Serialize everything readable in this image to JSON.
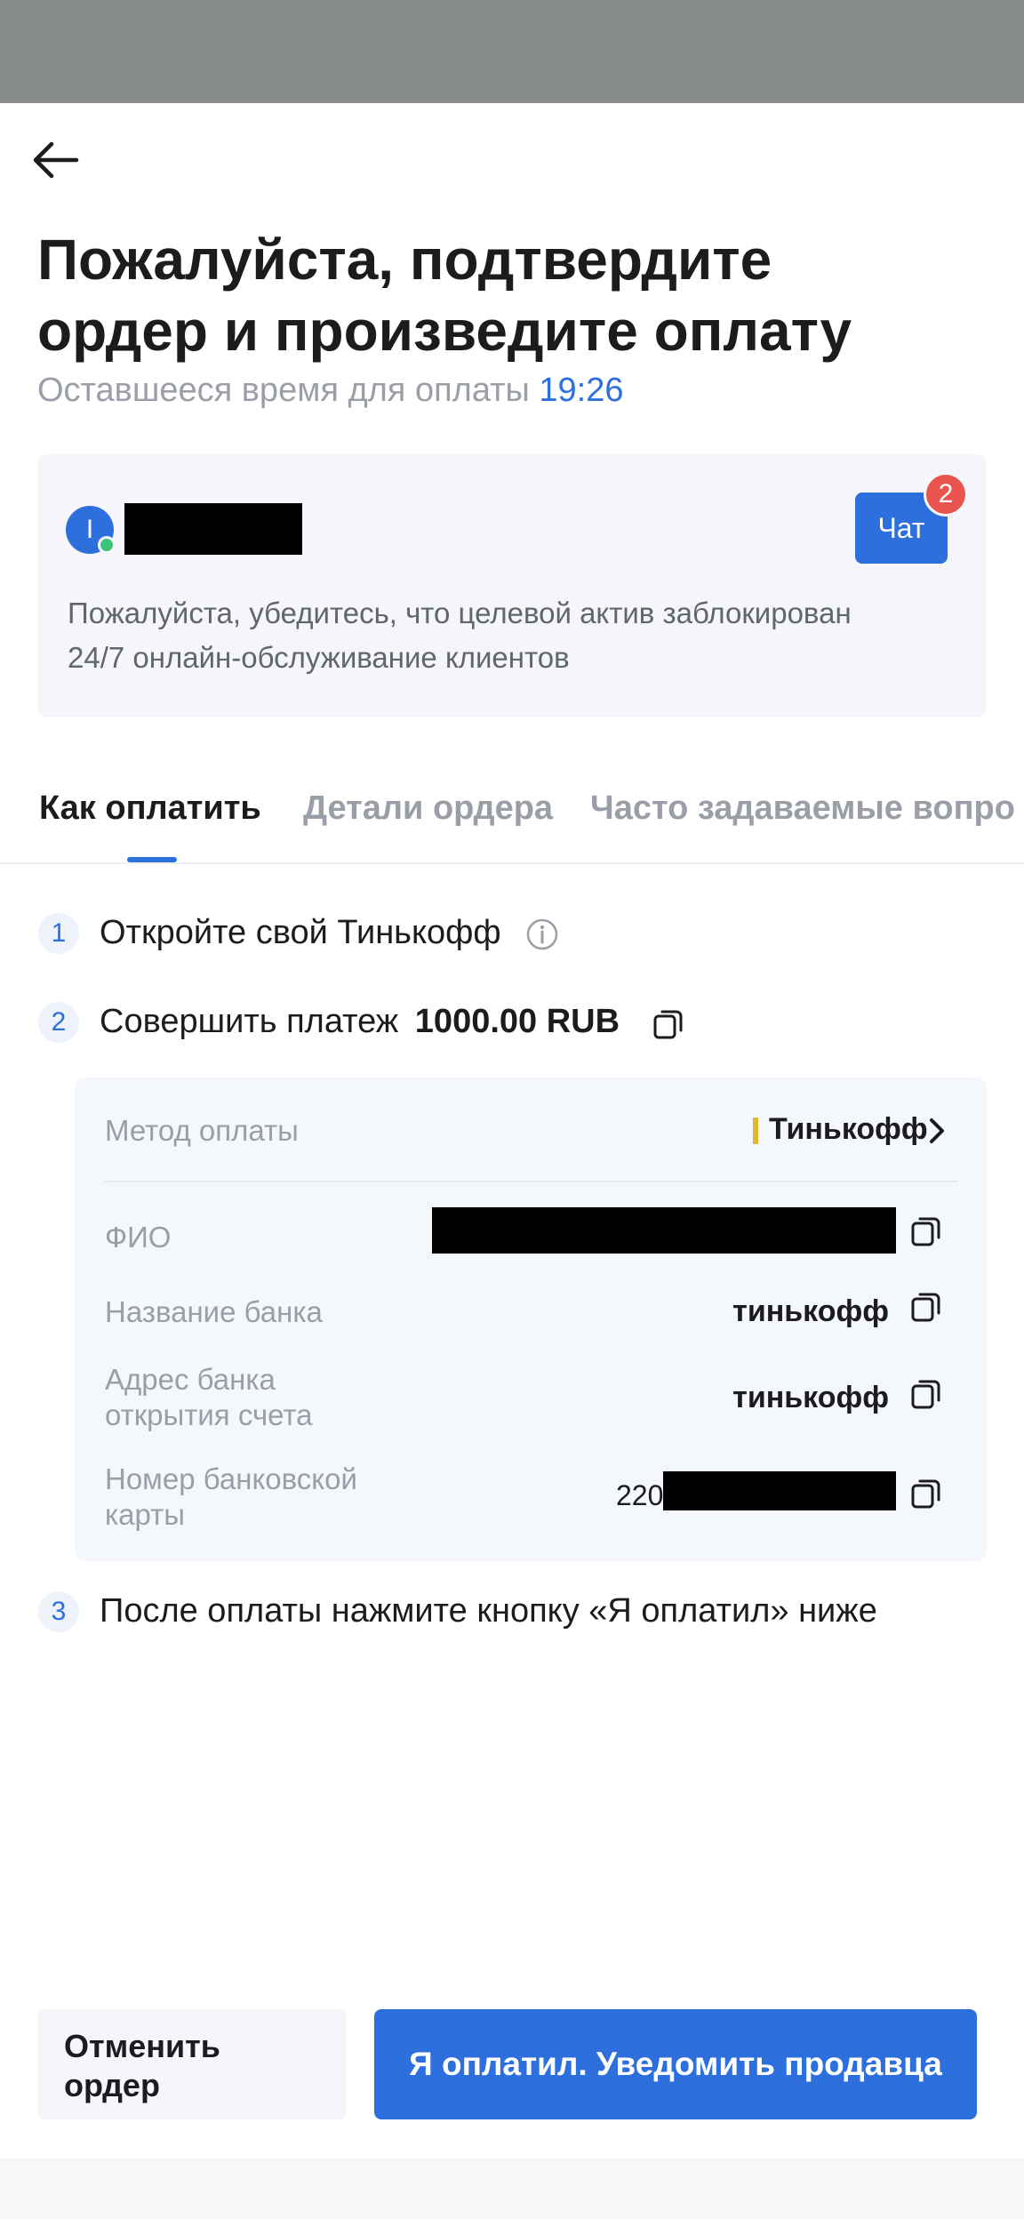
{
  "header": {
    "title_line1": "Пожалуйста, подтвердите",
    "title_line2": "ордер и произведите оплату",
    "timer_label": "Оставшееся время для оплаты",
    "timer_value": "19:26"
  },
  "seller": {
    "avatar_letter": "I",
    "name": "[redacted]",
    "chat_label": "Чат",
    "chat_badge": "2",
    "note_line1": "Пожалуйста, убедитесь, что целевой актив заблокирован",
    "note_line2": "24/7 онлайн-обслуживание клиентов"
  },
  "tabs": [
    {
      "label": "Как оплатить",
      "active": true
    },
    {
      "label": "Детали ордера",
      "active": false
    },
    {
      "label": "Часто задаваемые вопро",
      "active": false
    }
  ],
  "steps": {
    "step1": {
      "num": "1",
      "text": "Откройте свой Тинькофф"
    },
    "step2": {
      "num": "2",
      "text": "Совершить платеж",
      "amount": "1000.00 RUB"
    },
    "step3": {
      "num": "3",
      "text": "После оплаты нажмите кнопку «Я оплатил» ниже"
    }
  },
  "payment_details": {
    "method_label": "Метод оплаты",
    "method_value": "Тинькофф",
    "name_label": "ФИО",
    "name_value": "[redacted]",
    "bank_label": "Название банка",
    "bank_value": "тинькофф",
    "bank_address_label_line1": "Адрес банка",
    "bank_address_label_line2": "открытия счета",
    "bank_address_value": "тинькофф",
    "card_label_line1": "Номер банковской",
    "card_label_line2": "карты",
    "card_prefix": "220",
    "card_hidden": "[redacted]"
  },
  "actions": {
    "cancel_line1": "Отменить",
    "cancel_line2": "ордер",
    "paid_label": "Я оплатил. Уведомить продавца"
  },
  "colors": {
    "accent": "#2e6fde",
    "badge": "#e8544e",
    "method_bar": "#e1b833",
    "status_bar": "#898c8d"
  }
}
